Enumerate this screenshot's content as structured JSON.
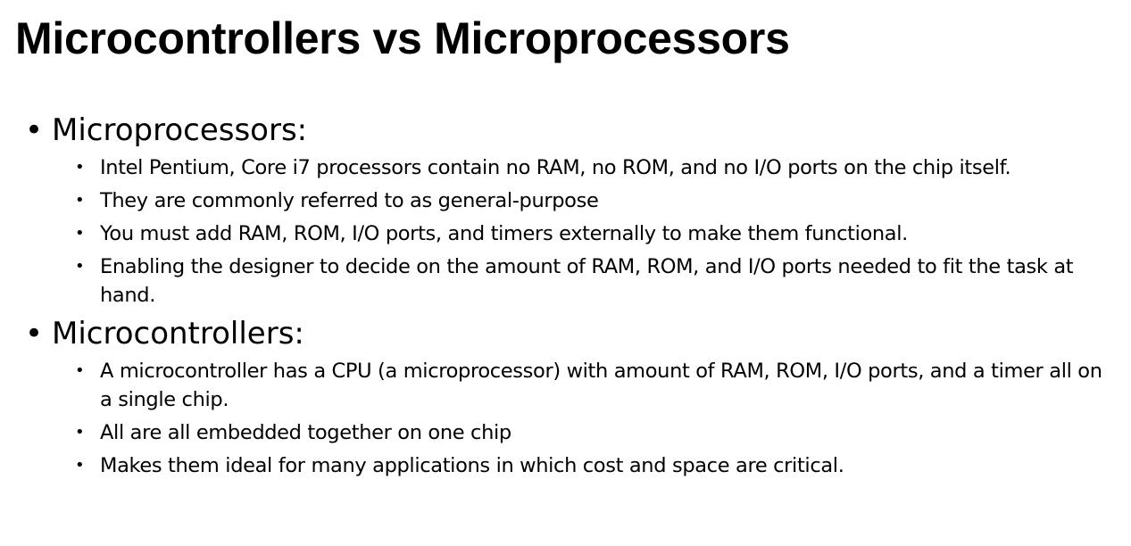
{
  "slide": {
    "title": "Microcontrollers vs Microprocessors",
    "bullet_glyph": "•",
    "sections": [
      {
        "heading": "Microprocessors:",
        "items": [
          "Intel Pentium, Core i7 processors contain no RAM, no ROM, and no I/O ports on the chip itself.",
          "They are commonly referred to as general-purpose",
          "You must add RAM, ROM, I/O ports, and timers externally to make them functional.",
          "Enabling the designer to decide on the amount of RAM, ROM, and I/O ports needed to fit the task at hand."
        ]
      },
      {
        "heading": "Microcontrollers:",
        "items": [
          "A microcontroller has a CPU (a microprocessor) with amount of RAM, ROM, I/O ports, and a timer all on a single chip.",
          "All are all embedded together on one chip",
          "Makes them ideal for many applications in which cost and space are critical."
        ]
      }
    ]
  }
}
